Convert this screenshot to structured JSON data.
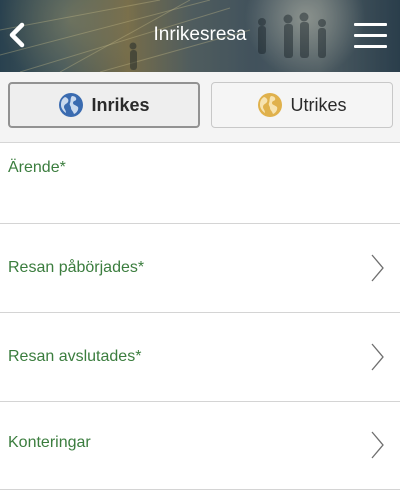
{
  "header": {
    "title": "Inrikesresa",
    "back_icon": "chevron-left-icon",
    "menu_icon": "hamburger-menu-icon"
  },
  "tabs": [
    {
      "label": "Inrikes",
      "icon": "globe-icon",
      "icon_color": "#3a6bb0",
      "active": true
    },
    {
      "label": "Utrikes",
      "icon": "globe-icon",
      "icon_color": "#e0b14c",
      "active": false
    }
  ],
  "fields": [
    {
      "label": "Ärende*"
    },
    {
      "label": "Resan påbörjades*"
    },
    {
      "label": "Resan avslutades*"
    },
    {
      "label": "Konteringar"
    }
  ],
  "colors": {
    "field_label": "#3b7d3e",
    "active_tab_border": "#929292",
    "divider": "#d4d4d4"
  }
}
